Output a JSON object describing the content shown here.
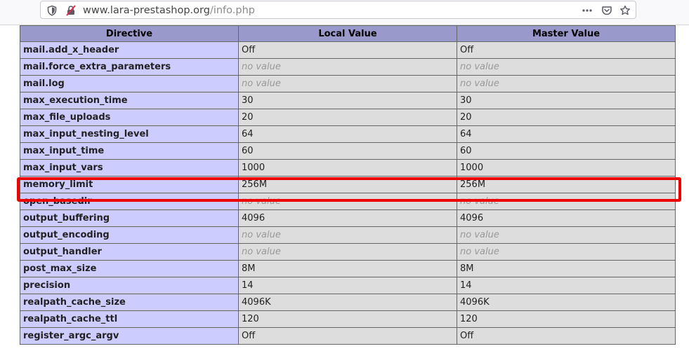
{
  "browser": {
    "url_host": "www.lara-prestashop.org",
    "url_path": "/info.php"
  },
  "table": {
    "headers": [
      "Directive",
      "Local Value",
      "Master Value"
    ],
    "rows": [
      {
        "directive": "mail.add_x_header",
        "local": "Off",
        "master": "Off"
      },
      {
        "directive": "mail.force_extra_parameters",
        "local": "no value",
        "master": "no value"
      },
      {
        "directive": "mail.log",
        "local": "no value",
        "master": "no value"
      },
      {
        "directive": "max_execution_time",
        "local": "30",
        "master": "30"
      },
      {
        "directive": "max_file_uploads",
        "local": "20",
        "master": "20"
      },
      {
        "directive": "max_input_nesting_level",
        "local": "64",
        "master": "64"
      },
      {
        "directive": "max_input_time",
        "local": "60",
        "master": "60"
      },
      {
        "directive": "max_input_vars",
        "local": "1000",
        "master": "1000"
      },
      {
        "directive": "memory_limit",
        "local": "256M",
        "master": "256M"
      },
      {
        "directive": "open_basedir",
        "local": "no value",
        "master": "no value"
      },
      {
        "directive": "output_buffering",
        "local": "4096",
        "master": "4096"
      },
      {
        "directive": "output_encoding",
        "local": "no value",
        "master": "no value"
      },
      {
        "directive": "output_handler",
        "local": "no value",
        "master": "no value"
      },
      {
        "directive": "post_max_size",
        "local": "8M",
        "master": "8M"
      },
      {
        "directive": "precision",
        "local": "14",
        "master": "14"
      },
      {
        "directive": "realpath_cache_size",
        "local": "4096K",
        "master": "4096K"
      },
      {
        "directive": "realpath_cache_ttl",
        "local": "120",
        "master": "120"
      },
      {
        "directive": "register_argc_argv",
        "local": "Off",
        "master": "Off"
      }
    ]
  },
  "highlight_color": "#ee0000",
  "colors": {
    "header_bg": "#9999cc",
    "directive_bg": "#ccccff",
    "value_bg": "#dddddd",
    "no_value_text": "#999999"
  }
}
